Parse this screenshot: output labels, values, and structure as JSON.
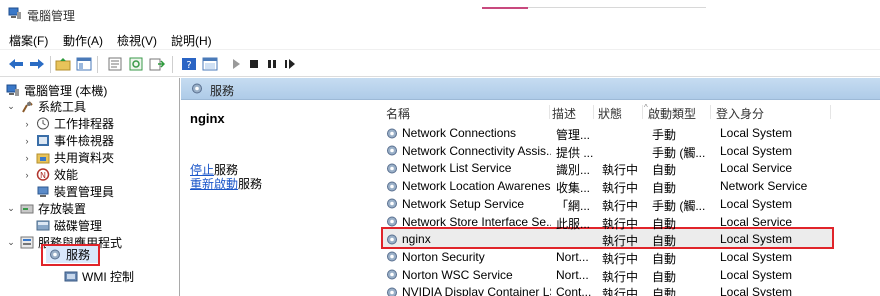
{
  "window": {
    "title": "電腦管理"
  },
  "menu": [
    "檔案(F)",
    "動作(A)",
    "檢視(V)",
    "說明(H)"
  ],
  "toolbar": {
    "buttons": [
      "back-icon",
      "forward-icon",
      "up-folder-icon",
      "show-hide-tree-icon",
      "properties-icon",
      "refresh-icon",
      "export-icon",
      "help-icon",
      "console-icon",
      "start-icon",
      "stop-icon",
      "pause-icon",
      "restart-icon"
    ]
  },
  "tree": {
    "root": "電腦管理 (本機)",
    "items": [
      {
        "label": "系統工具",
        "level": 1,
        "expanded": true
      },
      {
        "label": "工作排程器",
        "level": 2
      },
      {
        "label": "事件檢視器",
        "level": 2
      },
      {
        "label": "共用資料夾",
        "level": 2
      },
      {
        "label": "效能",
        "level": 2
      },
      {
        "label": "裝置管理員",
        "level": 2
      },
      {
        "label": "存放裝置",
        "level": 1,
        "expanded": true
      },
      {
        "label": "磁碟管理",
        "level": 2
      },
      {
        "label": "服務與應用程式",
        "level": 1,
        "expanded": true
      },
      {
        "label": "服務",
        "level": 2,
        "selected": true
      },
      {
        "label": "WMI 控制",
        "level": 2
      }
    ]
  },
  "pane": {
    "header": "服務",
    "selected_service": "nginx",
    "stop_link": "停止",
    "stop_suffix": "服務",
    "restart_link": "重新啟動",
    "restart_suffix": "服務"
  },
  "columns": [
    "名稱",
    "描述",
    "狀態",
    "啟動類型",
    "登入身分"
  ],
  "services": [
    {
      "name": "Network Connections",
      "desc": "管理...",
      "state": "",
      "start": "手動",
      "logon": "Local System"
    },
    {
      "name": "Network Connectivity Assis...",
      "desc": "提供 ...",
      "state": "",
      "start": "手動 (觸...",
      "logon": "Local System"
    },
    {
      "name": "Network List Service",
      "desc": "識別...",
      "state": "執行中",
      "start": "自動",
      "logon": "Local Service"
    },
    {
      "name": "Network Location Awareness",
      "desc": "收集...",
      "state": "執行中",
      "start": "自動",
      "logon": "Network Service"
    },
    {
      "name": "Network Setup Service",
      "desc": "「網...",
      "state": "執行中",
      "start": "手動 (觸...",
      "logon": "Local System"
    },
    {
      "name": "Network Store Interface Se...",
      "desc": "此服...",
      "state": "執行中",
      "start": "自動",
      "logon": "Local Service"
    },
    {
      "name": "nginx",
      "desc": "",
      "state": "執行中",
      "start": "自動",
      "logon": "Local System"
    },
    {
      "name": "Norton Security",
      "desc": "Nort...",
      "state": "執行中",
      "start": "自動",
      "logon": "Local System"
    },
    {
      "name": "Norton WSC Service",
      "desc": "Nort...",
      "state": "執行中",
      "start": "自動",
      "logon": "Local System"
    },
    {
      "name": "NVIDIA Display Container LS",
      "desc": "Cont...",
      "state": "執行中",
      "start": "自動",
      "logon": "Local System"
    }
  ],
  "colors": {
    "highlight": "#e0242a",
    "link": "#1a56c9",
    "header_bg": "#bcd5ee"
  }
}
